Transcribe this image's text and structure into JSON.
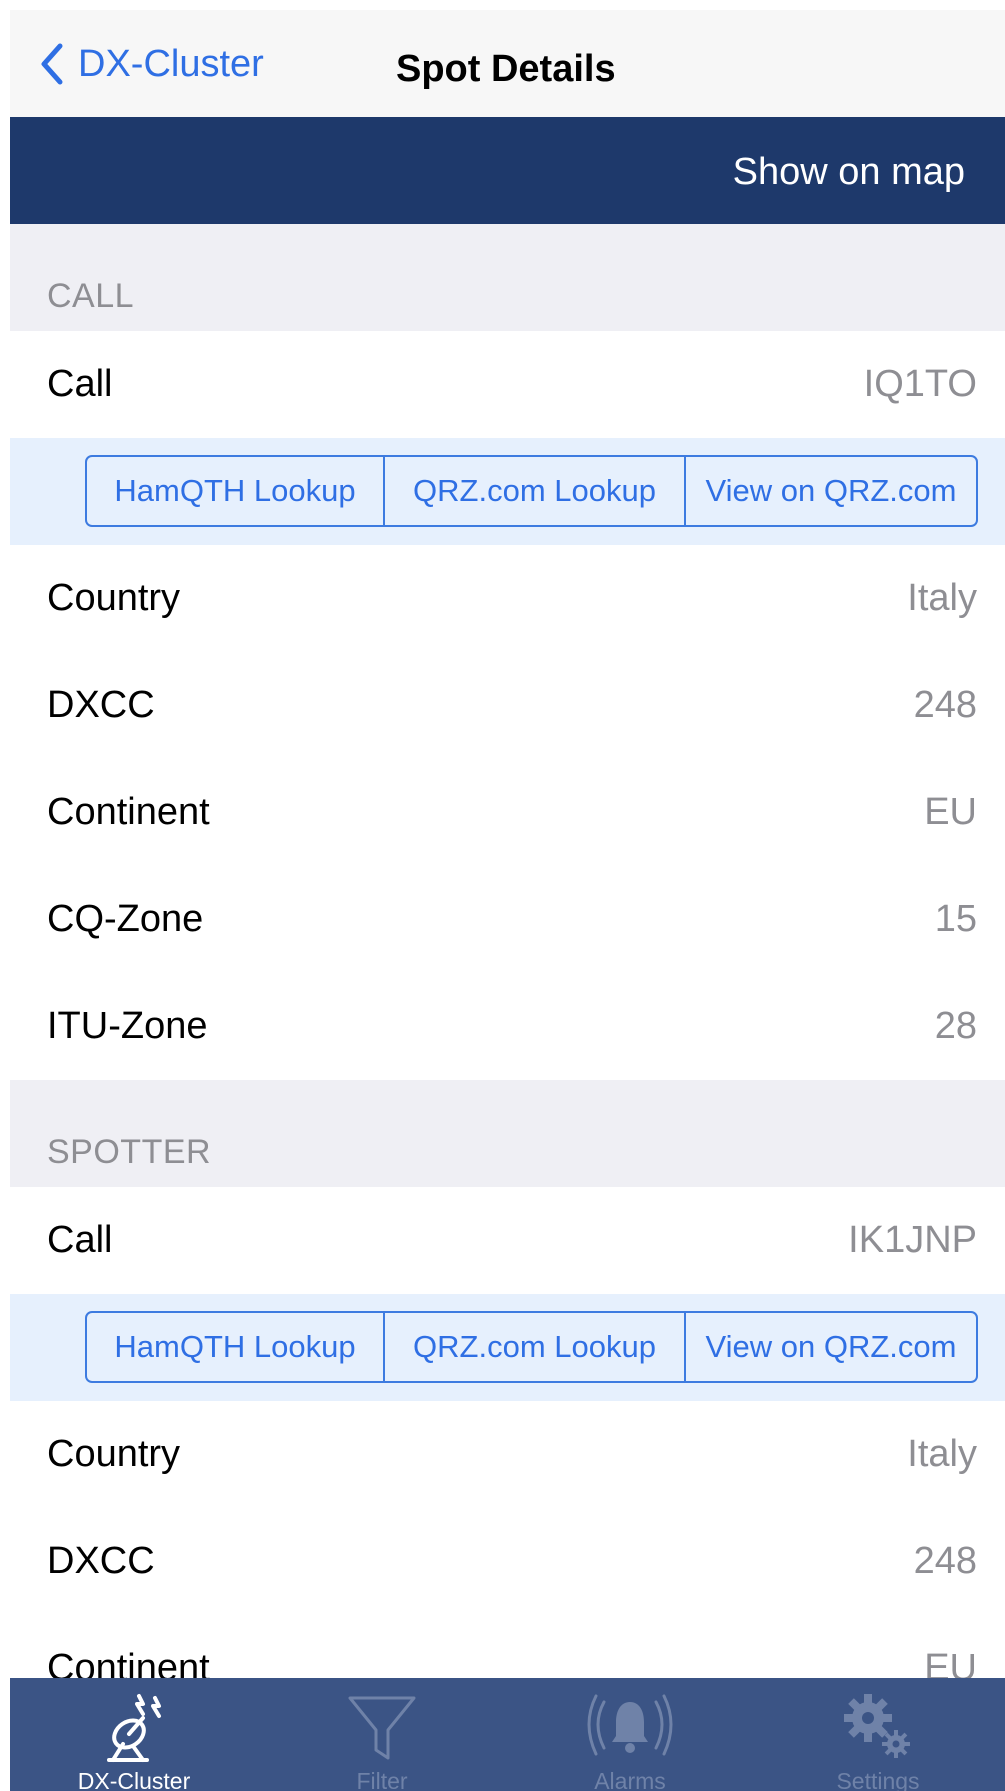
{
  "navbar": {
    "back_label": "DX-Cluster",
    "title": "Spot Details"
  },
  "map_button": "Show on map",
  "sections": {
    "call": {
      "header": "CALL",
      "call": {
        "label": "Call",
        "value": "IQ1TO"
      },
      "lookups": [
        "HamQTH Lookup",
        "QRZ.com Lookup",
        "View on QRZ.com"
      ],
      "details": [
        {
          "label": "Country",
          "value": "Italy"
        },
        {
          "label": "DXCC",
          "value": "248"
        },
        {
          "label": "Continent",
          "value": "EU"
        },
        {
          "label": "CQ-Zone",
          "value": "15"
        },
        {
          "label": "ITU-Zone",
          "value": "28"
        }
      ]
    },
    "spotter": {
      "header": "SPOTTER",
      "call": {
        "label": "Call",
        "value": "IK1JNP"
      },
      "lookups": [
        "HamQTH Lookup",
        "QRZ.com Lookup",
        "View on QRZ.com"
      ],
      "details": [
        {
          "label": "Country",
          "value": "Italy"
        },
        {
          "label": "DXCC",
          "value": "248"
        },
        {
          "label": "Continent",
          "value": "EU"
        }
      ]
    }
  },
  "tabbar": {
    "items": [
      {
        "label": "DX-Cluster",
        "icon": "dx-cluster-icon",
        "active": true
      },
      {
        "label": "Filter",
        "icon": "filter-icon",
        "active": false
      },
      {
        "label": "Alarms",
        "icon": "alarm-bell-icon",
        "active": false
      },
      {
        "label": "Settings",
        "icon": "gears-icon",
        "active": false
      }
    ]
  },
  "colors": {
    "accent": "#2f6fe4",
    "navy": "#1e396b",
    "tabbar": "#3b5485",
    "section_bg": "#efeff4",
    "button_row_bg": "#e6f0fd"
  }
}
